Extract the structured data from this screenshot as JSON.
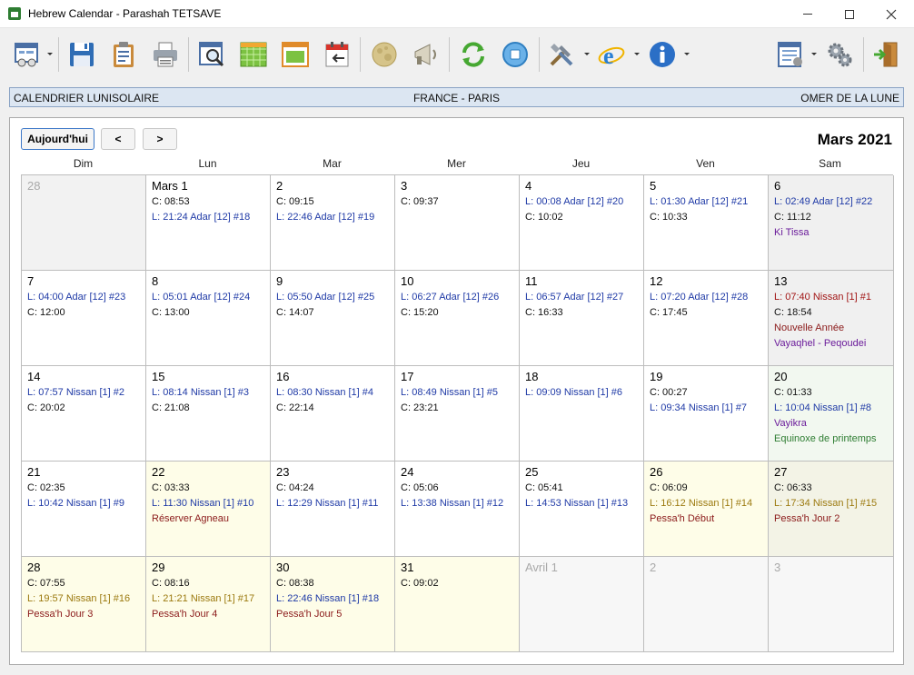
{
  "window": {
    "title": "Hebrew Calendar - Parashah TETSAVE"
  },
  "toolbar": {
    "icons": [
      "view-icon",
      "save-icon",
      "clipboard-icon",
      "print-icon",
      "search-calendar-icon",
      "month-grid-icon",
      "week-view-icon",
      "import-calendar-icon",
      "moon-icon",
      "announce-icon",
      "sync-icon",
      "stop-icon",
      "tools-icon",
      "internet-icon",
      "info-icon",
      "list-settings-icon",
      "gears-icon",
      "exit-icon"
    ]
  },
  "infobar": {
    "left": "CALENDRIER LUNISOLAIRE",
    "center": "FRANCE - PARIS",
    "right": "OMER DE LA LUNE"
  },
  "nav": {
    "today": "Aujourd'hui",
    "prev": "<",
    "next": ">"
  },
  "month_title": "Mars 2021",
  "weekdays": [
    "Dim",
    "Lun",
    "Mar",
    "Mer",
    "Jeu",
    "Ven",
    "Sam"
  ],
  "weeks": [
    [
      {
        "day": "28",
        "other": true,
        "bg": "bg-gray",
        "lines": []
      },
      {
        "day": "Mars 1",
        "lines": [
          {
            "t": "C: 08:53",
            "c": "c-candle"
          },
          {
            "t": "L: 21:24 Adar [12] #18",
            "c": "c-lune"
          }
        ]
      },
      {
        "day": "2",
        "lines": [
          {
            "t": "C: 09:15",
            "c": "c-candle"
          },
          {
            "t": "L: 22:46 Adar [12] #19",
            "c": "c-lune"
          }
        ]
      },
      {
        "day": "3",
        "lines": [
          {
            "t": "C: 09:37",
            "c": "c-candle"
          }
        ]
      },
      {
        "day": "4",
        "lines": [
          {
            "t": "L: 00:08 Adar [12] #20",
            "c": "c-lune"
          },
          {
            "t": "C: 10:02",
            "c": "c-candle"
          }
        ]
      },
      {
        "day": "5",
        "lines": [
          {
            "t": "L: 01:30 Adar [12] #21",
            "c": "c-lune"
          },
          {
            "t": "C: 10:33",
            "c": "c-candle"
          }
        ]
      },
      {
        "day": "6",
        "bg": "bg-sat",
        "lines": [
          {
            "t": "L: 02:49 Adar [12] #22",
            "c": "c-lune"
          },
          {
            "t": "C: 11:12",
            "c": "c-candle"
          },
          {
            "t": "Ki Tissa",
            "c": "c-parasha"
          }
        ]
      }
    ],
    [
      {
        "day": "7",
        "lines": [
          {
            "t": "L: 04:00 Adar [12] #23",
            "c": "c-lune"
          },
          {
            "t": "C: 12:00",
            "c": "c-candle"
          }
        ]
      },
      {
        "day": "8",
        "lines": [
          {
            "t": "L: 05:01 Adar [12] #24",
            "c": "c-lune"
          },
          {
            "t": "C: 13:00",
            "c": "c-candle"
          }
        ]
      },
      {
        "day": "9",
        "lines": [
          {
            "t": "L: 05:50 Adar [12] #25",
            "c": "c-lune"
          },
          {
            "t": "C: 14:07",
            "c": "c-candle"
          }
        ]
      },
      {
        "day": "10",
        "lines": [
          {
            "t": "L: 06:27 Adar [12] #26",
            "c": "c-lune"
          },
          {
            "t": "C: 15:20",
            "c": "c-candle"
          }
        ]
      },
      {
        "day": "11",
        "lines": [
          {
            "t": "L: 06:57 Adar [12] #27",
            "c": "c-lune"
          },
          {
            "t": "C: 16:33",
            "c": "c-candle"
          }
        ]
      },
      {
        "day": "12",
        "lines": [
          {
            "t": "L: 07:20 Adar [12] #28",
            "c": "c-lune"
          },
          {
            "t": "C: 17:45",
            "c": "c-candle"
          }
        ]
      },
      {
        "day": "13",
        "bg": "bg-sat",
        "lines": [
          {
            "t": "L: 07:40 Nissan [1] #1",
            "c": "c-lune-red"
          },
          {
            "t": "C: 18:54",
            "c": "c-candle"
          },
          {
            "t": "Nouvelle Année",
            "c": "c-event-red"
          },
          {
            "t": "Vayaqhel - Peqoudei",
            "c": "c-parasha"
          }
        ]
      }
    ],
    [
      {
        "day": "14",
        "lines": [
          {
            "t": "L: 07:57 Nissan [1] #2",
            "c": "c-lune"
          },
          {
            "t": "C: 20:02",
            "c": "c-candle"
          }
        ]
      },
      {
        "day": "15",
        "lines": [
          {
            "t": "L: 08:14 Nissan [1] #3",
            "c": "c-lune"
          },
          {
            "t": "C: 21:08",
            "c": "c-candle"
          }
        ]
      },
      {
        "day": "16",
        "lines": [
          {
            "t": "L: 08:30 Nissan [1] #4",
            "c": "c-lune"
          },
          {
            "t": "C: 22:14",
            "c": "c-candle"
          }
        ]
      },
      {
        "day": "17",
        "lines": [
          {
            "t": "L: 08:49 Nissan [1] #5",
            "c": "c-lune"
          },
          {
            "t": "C: 23:21",
            "c": "c-candle"
          }
        ]
      },
      {
        "day": "18",
        "lines": [
          {
            "t": "L: 09:09 Nissan [1] #6",
            "c": "c-lune"
          }
        ]
      },
      {
        "day": "19",
        "lines": [
          {
            "t": "C: 00:27",
            "c": "c-candle"
          },
          {
            "t": "L: 09:34 Nissan [1] #7",
            "c": "c-lune"
          }
        ]
      },
      {
        "day": "20",
        "bg": "bg-greenish",
        "lines": [
          {
            "t": "C: 01:33",
            "c": "c-candle"
          },
          {
            "t": "L: 10:04 Nissan [1] #8",
            "c": "c-lune"
          },
          {
            "t": "Vayikra",
            "c": "c-parasha"
          },
          {
            "t": "Equinoxe de printemps",
            "c": "c-green"
          }
        ]
      }
    ],
    [
      {
        "day": "21",
        "lines": [
          {
            "t": "C: 02:35",
            "c": "c-candle"
          },
          {
            "t": "L: 10:42 Nissan [1] #9",
            "c": "c-lune"
          }
        ]
      },
      {
        "day": "22",
        "bg": "bg-yellow",
        "lines": [
          {
            "t": "C: 03:33",
            "c": "c-candle"
          },
          {
            "t": "L: 11:30 Nissan [1] #10",
            "c": "c-lune"
          },
          {
            "t": "Réserver Agneau",
            "c": "c-event-red"
          }
        ]
      },
      {
        "day": "23",
        "lines": [
          {
            "t": "C: 04:24",
            "c": "c-candle"
          },
          {
            "t": "L: 12:29 Nissan [1] #11",
            "c": "c-lune"
          }
        ]
      },
      {
        "day": "24",
        "lines": [
          {
            "t": "C: 05:06",
            "c": "c-candle"
          },
          {
            "t": "L: 13:38 Nissan [1] #12",
            "c": "c-lune"
          }
        ]
      },
      {
        "day": "25",
        "lines": [
          {
            "t": "C: 05:41",
            "c": "c-candle"
          },
          {
            "t": "L: 14:53 Nissan [1] #13",
            "c": "c-lune"
          }
        ]
      },
      {
        "day": "26",
        "bg": "bg-yellow",
        "lines": [
          {
            "t": "C: 06:09",
            "c": "c-candle"
          },
          {
            "t": "L: 16:12 Nissan [1] #14",
            "c": "c-lune-gold"
          },
          {
            "t": "Pessa'h Début",
            "c": "c-event-red"
          }
        ]
      },
      {
        "day": "27",
        "bg": "bg-yellow-sat",
        "lines": [
          {
            "t": "C: 06:33",
            "c": "c-candle"
          },
          {
            "t": "L: 17:34 Nissan [1] #15",
            "c": "c-lune-gold"
          },
          {
            "t": "Pessa'h Jour 2",
            "c": "c-event-red"
          }
        ]
      }
    ],
    [
      {
        "day": "28",
        "bg": "bg-yellow",
        "lines": [
          {
            "t": "C: 07:55",
            "c": "c-candle"
          },
          {
            "t": "L: 19:57 Nissan [1] #16",
            "c": "c-lune-gold"
          },
          {
            "t": "Pessa'h Jour 3",
            "c": "c-event-red"
          }
        ]
      },
      {
        "day": "29",
        "bg": "bg-yellow",
        "lines": [
          {
            "t": "C: 08:16",
            "c": "c-candle"
          },
          {
            "t": "L: 21:21 Nissan [1] #17",
            "c": "c-lune-gold"
          },
          {
            "t": "Pessa'h Jour 4",
            "c": "c-event-red"
          }
        ]
      },
      {
        "day": "30",
        "bg": "bg-yellow",
        "lines": [
          {
            "t": "C: 08:38",
            "c": "c-candle"
          },
          {
            "t": "L: 22:46 Nissan [1] #18",
            "c": "c-lune"
          },
          {
            "t": "Pessa'h Jour 5",
            "c": "c-event-red"
          }
        ]
      },
      {
        "day": "31",
        "bg": "bg-yellow",
        "lines": [
          {
            "t": "C: 09:02",
            "c": "c-candle"
          }
        ]
      },
      {
        "day": "Avril 1",
        "other": true,
        "bg": "bg-other",
        "lines": []
      },
      {
        "day": "2",
        "other": true,
        "bg": "bg-other",
        "lines": []
      },
      {
        "day": "3",
        "other": true,
        "bg": "bg-other",
        "lines": []
      }
    ]
  ]
}
